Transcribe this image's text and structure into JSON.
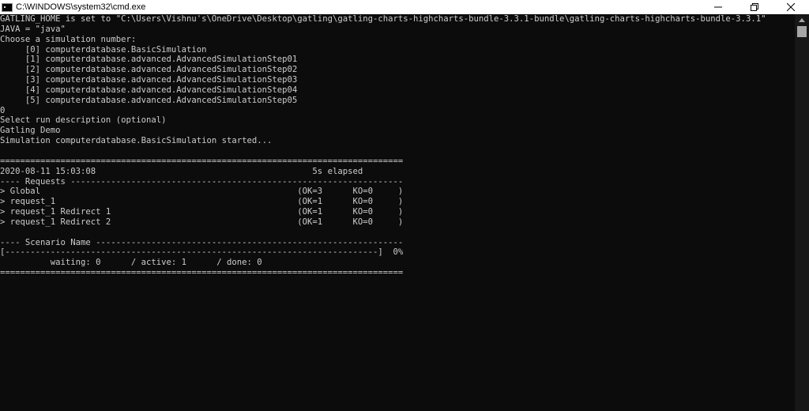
{
  "window": {
    "title": "C:\\WINDOWS\\system32\\cmd.exe",
    "app_icon": "cmd-icon",
    "controls": [
      {
        "name": "minimize-button",
        "icon": "minimize-icon"
      },
      {
        "name": "restore-button",
        "icon": "restore-icon"
      },
      {
        "name": "close-button",
        "icon": "close-icon"
      }
    ]
  },
  "console": {
    "text_color": "#cccccc",
    "background": "#0c0c0c",
    "lines": [
      "GATLING_HOME is set to \"C:\\Users\\Vishnu's\\OneDrive\\Desktop\\gatling\\gatling-charts-highcharts-bundle-3.3.1-bundle\\gatling-charts-highcharts-bundle-3.3.1\"",
      "JAVA = \"java\"",
      "Choose a simulation number:",
      "     [0] computerdatabase.BasicSimulation",
      "     [1] computerdatabase.advanced.AdvancedSimulationStep01",
      "     [2] computerdatabase.advanced.AdvancedSimulationStep02",
      "     [3] computerdatabase.advanced.AdvancedSimulationStep03",
      "     [4] computerdatabase.advanced.AdvancedSimulationStep04",
      "     [5] computerdatabase.advanced.AdvancedSimulationStep05",
      "0",
      "Select run description (optional)",
      "Gatling Demo",
      "Simulation computerdatabase.BasicSimulation started...",
      "",
      "================================================================================",
      "2020-08-11 15:03:08                                           5s elapsed",
      "---- Requests ------------------------------------------------------------------",
      "> Global                                                   (OK=3      KO=0     )",
      "> request_1                                                (OK=1      KO=0     )",
      "> request_1 Redirect 1                                     (OK=1      KO=0     )",
      "> request_1 Redirect 2                                     (OK=1      KO=0     )",
      "",
      "---- Scenario Name -------------------------------------------------------------",
      "[--------------------------------------------------------------------------]  0%",
      "          waiting: 0      / active: 1      / done: 0",
      "================================================================================"
    ]
  },
  "scrollbar": {
    "up_arrow": "scroll-up-arrow-icon",
    "thumb_color": "#a6a6a6"
  }
}
